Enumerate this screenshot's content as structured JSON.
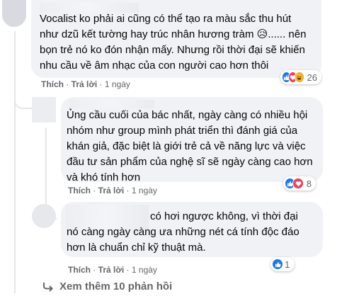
{
  "comments": [
    {
      "text": "Vocalist ko phải ai cũng có thể tạo ra màu sắc thu hút\nnhư dzũ kết tường hay trúc nhân hương tràm 😥...... nên\nbọn trẻ nó ko đón nhận mấy. Nhưng rồi thời đại sẽ khiến\nnhu cầu về âm nhạc của con người cao hơn thôi",
      "like_label": "Thích",
      "reply_label": "Trả lời",
      "time": "1 ngày",
      "reaction_count": "26",
      "reactions": [
        "like-icon",
        "love-icon",
        "haha-icon"
      ]
    },
    {
      "text": "Ủng cầu cuối của bác nhất, ngày càng có nhiều hội\nnhóm như group mình phát triển thì đánh giá của\nkhán giả, đặc biệt là giới trẻ cả về năng lực và việc\nđầu tư sản phẩm của nghệ sĩ sẽ ngày càng cao hơn\nvà khó tính hơn",
      "like_label": "Thích",
      "reply_label": "Trả lời",
      "time": "1 ngày",
      "reaction_count": "8",
      "reactions": [
        "like-icon",
        "love-icon"
      ]
    },
    {
      "text": "có hơi ngược không, vì thời đại\nnó càng ngày càng ưa những nét cá tính độc đáo\nhơn là chuẩn chỉ kỹ thuật mà.",
      "like_label": "Thích",
      "reply_label": "Trả lời",
      "time": "1 ngày",
      "reaction_count": "1",
      "reactions": [
        "like-icon"
      ]
    }
  ],
  "view_more": {
    "label": "Xem thêm 10 phản hồi",
    "icon": "reply-arrow-icon"
  },
  "colors": {
    "bubble": "#f0f2f5",
    "meta": "#65676b",
    "like": "#1877f2",
    "love": "#f33e58",
    "haha": "#f7b125"
  }
}
